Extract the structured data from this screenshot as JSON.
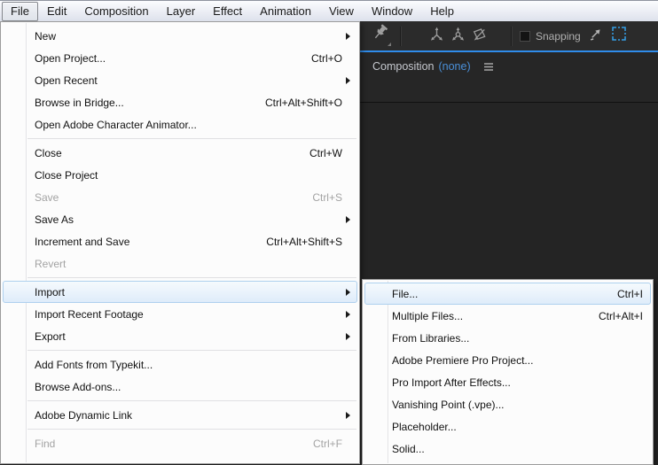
{
  "menubar": {
    "items": [
      "File",
      "Edit",
      "Composition",
      "Layer",
      "Effect",
      "Animation",
      "View",
      "Window",
      "Help"
    ],
    "active_item": "File"
  },
  "file_menu": {
    "items": [
      {
        "label": "New",
        "shortcut": "",
        "has_submenu": true
      },
      {
        "label": "Open Project...",
        "shortcut": "Ctrl+O"
      },
      {
        "label": "Open Recent",
        "shortcut": "",
        "has_submenu": true
      },
      {
        "label": "Browse in Bridge...",
        "shortcut": "Ctrl+Alt+Shift+O"
      },
      {
        "label": "Open Adobe Character Animator...",
        "shortcut": ""
      },
      {
        "label": "Close",
        "shortcut": "Ctrl+W"
      },
      {
        "label": "Close Project",
        "shortcut": ""
      },
      {
        "label": "Save",
        "shortcut": "Ctrl+S",
        "disabled": true
      },
      {
        "label": "Save As",
        "shortcut": "",
        "has_submenu": true
      },
      {
        "label": "Increment and Save",
        "shortcut": "Ctrl+Alt+Shift+S"
      },
      {
        "label": "Revert",
        "shortcut": "",
        "disabled": true
      },
      {
        "label": "Import",
        "shortcut": "",
        "has_submenu": true,
        "highlighted": true
      },
      {
        "label": "Import Recent Footage",
        "shortcut": "",
        "has_submenu": true
      },
      {
        "label": "Export",
        "shortcut": "",
        "has_submenu": true
      },
      {
        "label": "Add Fonts from Typekit...",
        "shortcut": ""
      },
      {
        "label": "Browse Add-ons...",
        "shortcut": ""
      },
      {
        "label": "Adobe Dynamic Link",
        "shortcut": "",
        "has_submenu": true
      },
      {
        "label": "Find",
        "shortcut": "Ctrl+F",
        "disabled": true
      }
    ]
  },
  "import_submenu": {
    "items": [
      {
        "label": "File...",
        "shortcut": "Ctrl+I",
        "highlighted": true
      },
      {
        "label": "Multiple Files...",
        "shortcut": "Ctrl+Alt+I"
      },
      {
        "label": "From Libraries...",
        "shortcut": ""
      },
      {
        "label": "Adobe Premiere Pro Project...",
        "shortcut": ""
      },
      {
        "label": "Pro Import After Effects...",
        "shortcut": ""
      },
      {
        "label": "Vanishing Point (.vpe)...",
        "shortcut": ""
      },
      {
        "label": "Placeholder...",
        "shortcut": ""
      },
      {
        "label": "Solid...",
        "shortcut": ""
      }
    ]
  },
  "toolbar": {
    "snapping_label": "Snapping",
    "snapping_checked": false,
    "icons": [
      "puppet-pin-icon",
      "local-axis-mode-icon",
      "world-axis-mode-icon",
      "view-axis-mode-icon",
      "zoom-arrow-icon",
      "region-of-interest-icon"
    ]
  },
  "composition_panel": {
    "tab_label": "Composition",
    "tab_value": "(none)",
    "icons": [
      "panel-menu-hamburger-icon"
    ]
  },
  "colors": {
    "accent_blue": "#2f8ceb",
    "tab_value_blue": "#4a90d9",
    "toolbar_bg": "#2b2b2b",
    "panel_bg": "#242424",
    "menu_highlight_border": "#aed0ee",
    "disabled_text": "#a3a3a3"
  }
}
